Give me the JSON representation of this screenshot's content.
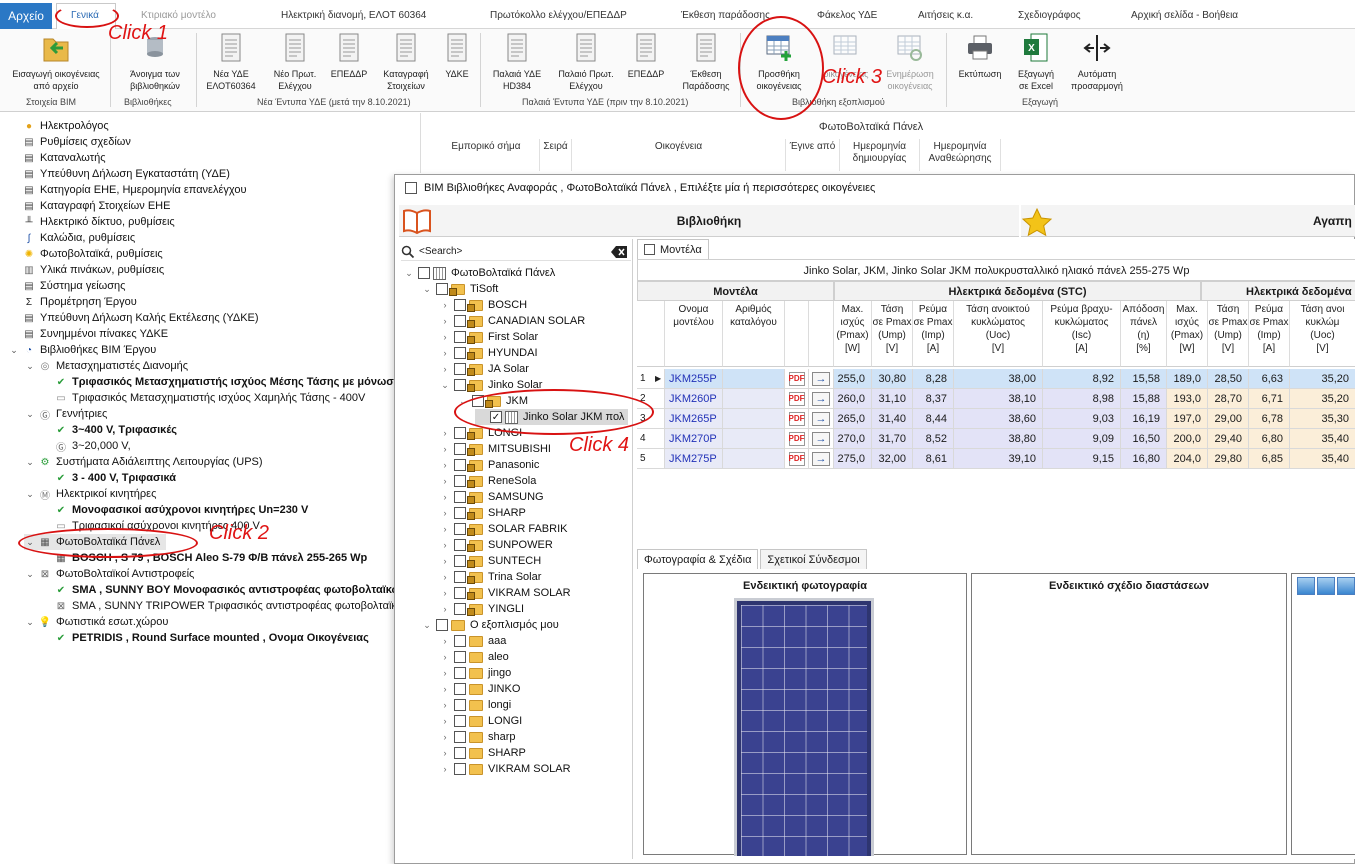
{
  "menu": {
    "file": "Αρχείο",
    "tabs": [
      {
        "label": "Γενικά",
        "active": true
      },
      {
        "label": "Κτιριακό μοντέλο"
      },
      {
        "label": "Ηλεκτρική διανομή, ΕΛΟΤ 60364"
      },
      {
        "label": "Πρωτόκολλο ελέγχου/ΕΠΕΔΔΡ"
      },
      {
        "label": "Έκθεση παράδοσης"
      },
      {
        "label": "Φάκελος ΥΔΕ"
      },
      {
        "label": "Αιτήσεις κ.α."
      },
      {
        "label": "Σχεδιογράφος"
      },
      {
        "label": "Αρχική σελίδα - Βοήθεια"
      }
    ]
  },
  "ribbon": {
    "buttons": [
      {
        "label": "Εισαγωγή οικογένειας\nαπό αρχείο",
        "icon": "folder-import-icon"
      },
      {
        "label": "Άνοιγμα των\nβιβλιοθηκών",
        "icon": "database-icon"
      },
      {
        "label": "Νέα ΥΔΕ\nΕΛΟΤ60364",
        "icon": "form-icon"
      },
      {
        "label": "Νέο Πρωτ.\nΕλέγχου",
        "icon": "form-icon"
      },
      {
        "label": "ΕΠΕΔΔΡ",
        "icon": "form-icon"
      },
      {
        "label": "Καταγραφή\nΣτοιχείων",
        "icon": "form-icon"
      },
      {
        "label": "ΥΔΚΕ",
        "icon": "form-icon"
      },
      {
        "label": "Παλαιά ΥΔΕ\nHD384",
        "icon": "form-icon"
      },
      {
        "label": "Παλαιό Πρωτ.\nΕλέγχου",
        "icon": "form-icon"
      },
      {
        "label": "ΕΠΕΔΔΡ",
        "icon": "form-icon"
      },
      {
        "label": "Έκθεση\nΠαράδοσης",
        "icon": "form-icon"
      },
      {
        "label": "Προσθήκη\nοικογένειας",
        "icon": "table-add-icon"
      },
      {
        "label": "οικογένειας",
        "icon": "table-edit-icon"
      },
      {
        "label": "Ενημέρωση\nοικογένειας",
        "icon": "table-refresh-icon"
      },
      {
        "label": "Εκτύπωση",
        "icon": "printer-icon"
      },
      {
        "label": "Εξαγωγή\nσε Excel",
        "icon": "excel-icon"
      },
      {
        "label": "Αυτόματη\nπροσαρμογή",
        "icon": "autofit-icon"
      }
    ],
    "groups": [
      "Στοιχεία BIM",
      "Βιβλιοθήκες",
      "Νέα Έντυπα ΥΔΕ (μετά την 8.10.2021)",
      "Παλαιά Έντυπα ΥΔΕ (πριν την 8.10.2021)",
      "Βιβλιοθήκη εξοπλισμού",
      "Εξαγωγή"
    ]
  },
  "left_tree": [
    {
      "label": "Ηλεκτρολόγος",
      "icon": "user-icon"
    },
    {
      "label": "Ρυθμίσεις σχεδίων",
      "icon": "settings-doc-icon"
    },
    {
      "label": "Καταναλωτής",
      "icon": "doc-icon"
    },
    {
      "label": "Υπεύθυνη Δήλωση Εγκαταστάτη (ΥΔΕ)",
      "icon": "doc-icon"
    },
    {
      "label": "Κατηγορία ΕΗΕ, Ημερομηνία επανελέγχου",
      "icon": "doc-icon"
    },
    {
      "label": "Καταγραφή Στοιχείων ΕΗΕ",
      "icon": "doc-icon"
    },
    {
      "label": "Ηλεκτρικό δίκτυο, ρυθμίσεις",
      "icon": "network-icon"
    },
    {
      "label": "Καλώδια, ρυθμίσεις",
      "icon": "cable-icon"
    },
    {
      "label": "Φωτοβολταϊκά, ρυθμίσεις",
      "icon": "sun-icon"
    },
    {
      "label": "Υλικά πινάκων, ρυθμίσεις",
      "icon": "panel-icon"
    },
    {
      "label": "Σύστημα γείωσης",
      "icon": "doc-icon"
    },
    {
      "label": "Προμέτρηση Έργου",
      "icon": "sigma-icon"
    },
    {
      "label": "Υπεύθυνη Δήλωση Καλής Εκτέλεσης (ΥΔΚΕ)",
      "icon": "doc-icon"
    },
    {
      "label": "Συνημμένοι πίνακες ΥΔΚΕ",
      "icon": "doc-icon"
    },
    {
      "label": "Βιβλιοθήκες BIM Έργου",
      "icon": "bim-icon",
      "expanded": true
    },
    {
      "label": "Μετασχηματιστές Διανομής",
      "icon": "transformer-icon",
      "level": 1,
      "expanded": true
    },
    {
      "label": "Τριφασικός Μετασχηματιστής ισχύος Μέσης Τάσης με μόνωση",
      "icon": "check-icon",
      "level": 2,
      "bold": true
    },
    {
      "label": "Τριφασικός Μετασχηματιστής ισχύος Χαμηλής Τάσης - 400V",
      "icon": "item-icon",
      "level": 2
    },
    {
      "label": "Γεννήτριες",
      "icon": "generator-icon",
      "level": 1,
      "expanded": true
    },
    {
      "label": "3~400 V, Τριφασικές",
      "icon": "check-icon",
      "level": 2,
      "bold": true
    },
    {
      "label": "3~20,000 V,",
      "icon": "generator-icon",
      "level": 2
    },
    {
      "label": "Συστήματα Αδιάλειπτης Λειτουργίας (UPS)",
      "icon": "ups-icon",
      "level": 1,
      "expanded": true
    },
    {
      "label": "3 - 400 V, Τριφασικά",
      "icon": "check-icon",
      "level": 2,
      "bold": true
    },
    {
      "label": "Ηλεκτρικοί κινητήρες",
      "icon": "motor-icon",
      "level": 1,
      "expanded": true
    },
    {
      "label": "Μονοφασικοί ασύχρονοι κινητήρες Un=230 V",
      "icon": "check-icon",
      "level": 2,
      "bold": true
    },
    {
      "label": "Τριφασικοί ασύχρονοι κινητήρες 400 V",
      "icon": "item-icon",
      "level": 2
    },
    {
      "label": "ΦωτοΒολταϊκά Πάνελ",
      "icon": "pv-panel-icon",
      "level": 1,
      "expanded": true,
      "selected": true
    },
    {
      "label": "BOSCH , S 79 , BOSCH Aleo S-79 Φ/Β πάνελ 255-265 Wp",
      "icon": "pv-panel-icon",
      "level": 2,
      "bold": true
    },
    {
      "label": "ΦωτοΒολταϊκοί Αντιστροφείς",
      "icon": "inverter-icon",
      "level": 1,
      "expanded": true
    },
    {
      "label": "SMA , SUNNY BOY Μονοφασικός αντιστροφέας φωτοβολταϊκών",
      "icon": "check-icon",
      "level": 2,
      "bold": true
    },
    {
      "label": "SMA , SUNNY TRIPOWER Τριφασικός αντιστροφέας φωτοβολταϊκών",
      "icon": "inverter-icon",
      "level": 2
    },
    {
      "label": "Φωτιστικά εσωτ.χώρου",
      "icon": "bulb-icon",
      "level": 1,
      "expanded": true
    },
    {
      "label": "PETRIDIS , Round Surface mounted , Ονομα Οικογένειας",
      "icon": "check-icon",
      "level": 2,
      "bold": true
    }
  ],
  "bg_grid": {
    "title": "ΦωτοΒολταϊκά Πάνελ",
    "columns": [
      "Εμπορικό σήμα",
      "Σειρά",
      "Οικογένεια",
      "Έγινε από",
      "Ημερομηνία\nδημιουργίας",
      "Ημερομηνία\nΑναθεώρησης"
    ]
  },
  "dialog": {
    "title": "BIM Βιβλιοθήκες Αναφοράς , ΦωτοΒολταϊκά Πάνελ , Επιλέξτε μία ή περισσότερες οικογένειες",
    "library_header": "Βιβλιοθήκη",
    "favorites_header": "Αγαπη",
    "search_placeholder": "<Search>",
    "tree": [
      {
        "label": "ΦωτοΒολταϊκά Πάνελ",
        "level": 0,
        "expanded": true,
        "icon": "pv-panel-icon"
      },
      {
        "label": "TiSoft",
        "level": 1,
        "expanded": true,
        "locked": true
      },
      {
        "label": "BOSCH",
        "level": 2,
        "locked": true
      },
      {
        "label": "CANADIAN SOLAR",
        "level": 2,
        "locked": true
      },
      {
        "label": "First Solar",
        "level": 2,
        "locked": true
      },
      {
        "label": "HYUNDAI",
        "level": 2,
        "locked": true
      },
      {
        "label": "JA Solar",
        "level": 2,
        "locked": true
      },
      {
        "label": "Jinko Solar",
        "level": 2,
        "expanded": true,
        "locked": true
      },
      {
        "label": "JKM",
        "level": 3,
        "expanded": true,
        "locked": true
      },
      {
        "label": "Jinko Solar JKM πολ",
        "level": 4,
        "checked": true,
        "selected": true,
        "icon": "pv-panel-icon"
      },
      {
        "label": "LONGI",
        "level": 2,
        "locked": true
      },
      {
        "label": "MITSUBISHI",
        "level": 2,
        "locked": true
      },
      {
        "label": "Panasonic",
        "level": 2,
        "locked": true
      },
      {
        "label": "ReneSola",
        "level": 2,
        "locked": true
      },
      {
        "label": "SAMSUNG",
        "level": 2,
        "locked": true
      },
      {
        "label": "SHARP",
        "level": 2,
        "locked": true
      },
      {
        "label": "SOLAR FABRIK",
        "level": 2,
        "locked": true
      },
      {
        "label": "SUNPOWER",
        "level": 2,
        "locked": true
      },
      {
        "label": "SUNTECH",
        "level": 2,
        "locked": true
      },
      {
        "label": "Trina Solar",
        "level": 2,
        "locked": true
      },
      {
        "label": "VIKRAM SOLAR",
        "level": 2,
        "locked": true
      },
      {
        "label": "YINGLI",
        "level": 2,
        "locked": true
      },
      {
        "label": "Ο εξοπλισμός μου",
        "level": 1,
        "expanded": true
      },
      {
        "label": "aaa",
        "level": 2
      },
      {
        "label": "aleo",
        "level": 2
      },
      {
        "label": "jingo",
        "level": 2
      },
      {
        "label": "JINKO",
        "level": 2
      },
      {
        "label": "longi",
        "level": 2
      },
      {
        "label": "LONGI",
        "level": 2
      },
      {
        "label": "sharp",
        "level": 2
      },
      {
        "label": "SHARP",
        "level": 2
      },
      {
        "label": "VIKRAM SOLAR",
        "level": 2
      }
    ],
    "models_tab": "Μοντέλα",
    "grid_caption": "Jinko Solar, JKM, Jinko Solar JKM πολυκρυσταλλικό ηλιακό πάνελ 255-275 Wp",
    "groups": [
      "Μοντέλα",
      "Ηλεκτρικά δεδομένα (STC)",
      "Ηλεκτρικά δεδομένα"
    ],
    "columns": [
      "Ονομα\nμοντέλου",
      "Αριθμός\nκαταλόγου",
      "Max.\nισχύς\n(Pmax)\n[W]",
      "Τάση\nσε Pmax\n(Ump)\n[V]",
      "Ρεύμα\nσε Pmax\n(Imp)\n[A]",
      "Τάση ανοικτού\nκυκλώματος\n(Uoc)\n[V]",
      "Ρεύμα βραχυ-\nκυκλώματος\n(Isc)\n[A]",
      "Απόδοση\nπάνελ\n(η)\n[%]",
      "Max.\nισχύς\n(Pmax)\n[W]",
      "Τάση\nσε Pmax\n(Ump)\n[V]",
      "Ρεύμα\nσε Pmax\n(Imp)\n[A]",
      "Τάση ανοι\nκυκλώμ\n(Uoc)\n[V]"
    ],
    "rows": [
      {
        "idx": "1",
        "model": "JKM255P",
        "stc": [
          "255,0",
          "30,80",
          "8,28",
          "38,00",
          "8,92",
          "15,58"
        ],
        "noct": [
          "189,0",
          "28,50",
          "6,63",
          "35,20"
        ]
      },
      {
        "idx": "2",
        "model": "JKM260P",
        "stc": [
          "260,0",
          "31,10",
          "8,37",
          "38,10",
          "8,98",
          "15,88"
        ],
        "noct": [
          "193,0",
          "28,70",
          "6,71",
          "35,20"
        ]
      },
      {
        "idx": "3",
        "model": "JKM265P",
        "stc": [
          "265,0",
          "31,40",
          "8,44",
          "38,60",
          "9,03",
          "16,19"
        ],
        "noct": [
          "197,0",
          "29,00",
          "6,78",
          "35,30"
        ]
      },
      {
        "idx": "4",
        "model": "JKM270P",
        "stc": [
          "270,0",
          "31,70",
          "8,52",
          "38,80",
          "9,09",
          "16,50"
        ],
        "noct": [
          "200,0",
          "29,40",
          "6,80",
          "35,40"
        ]
      },
      {
        "idx": "5",
        "model": "JKM275P",
        "stc": [
          "275,0",
          "32,00",
          "8,61",
          "39,10",
          "9,15",
          "16,80"
        ],
        "noct": [
          "204,0",
          "29,80",
          "6,85",
          "35,40"
        ]
      }
    ],
    "bottom_tabs": [
      "Φωτογραφία & Σχέδια",
      "Σχετικοί Σύνδεσμοι"
    ],
    "photo_title": "Ενδεικτική φωτογραφία",
    "drawing_title": "Ενδεικτικό σχέδιο διαστάσεων"
  },
  "annotations": [
    "Click 1",
    "Click 2",
    "Click 3",
    "Click 4"
  ],
  "colors": {
    "accent": "#2b78c5",
    "annotation": "#e01414",
    "selected_row": "#cfe3f7",
    "stc_band": "#e3e3f7",
    "noct_band": "#fbeed9"
  }
}
